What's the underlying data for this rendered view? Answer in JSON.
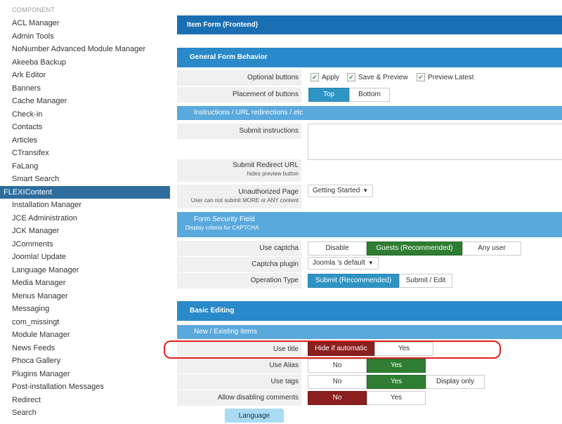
{
  "sidebar": {
    "section_label": "COMPONENT",
    "items": [
      "ACL Manager",
      "Admin Tools",
      "NoNumber Advanced Module Manager",
      "Akeeba Backup",
      "Ark Editor",
      "Banners",
      "Cache Manager",
      "Check-in",
      "Contacts",
      "Articles",
      "CTransifex",
      "FaLang",
      "Smart Search",
      "FLEXIContent",
      "Installation Manager",
      "JCE Administration",
      "JCK Manager",
      "JComments",
      "Joomla! Update",
      "Language Manager",
      "Media Manager",
      "Menus Manager",
      "Messaging",
      "com_missingt",
      "Module Manager",
      "News Feeds",
      "Phoca Gallery",
      "Plugins Manager",
      "Post-installation Messages",
      "Redirect",
      "Search"
    ],
    "active_index": 13
  },
  "main": {
    "item_form_title": "Item Form (Frontend)",
    "general_title": "General Form Behavior",
    "optional_buttons_label": "Optional buttons",
    "optional_buttons": [
      "Apply",
      "Save & Preview",
      "Preview Latest"
    ],
    "placement_label": "Placement of buttons",
    "placement_options": [
      "Top",
      "Bottom"
    ],
    "instructions_sub": "Instructions / URL redirections / etc",
    "submit_instructions_label": "Submit instructions",
    "submit_redirect_label": "Submit Redirect URL",
    "submit_redirect_help": "hides preview button",
    "unauthorized_label": "Unauthorized Page",
    "unauthorized_help": "User can not submit MORE or ANY content",
    "unauthorized_value": "Getting Started",
    "security_sub": "Form Security Field",
    "security_sub_help": "Display criteria for CAPTCHA",
    "use_captcha_label": "Use captcha",
    "use_captcha_options": [
      "Disable",
      "Guests (Recommended)",
      "Any user"
    ],
    "captcha_plugin_label": "Captcha plugin",
    "captcha_plugin_value": "Joomla 's default",
    "operation_type_label": "Operation Type",
    "operation_type_options": [
      "Submit (Recommended)",
      "Submit / Edit"
    ],
    "basic_editing_title": "Basic Editing",
    "new_existing_sub": "New / Existing items",
    "use_title_label": "Use title",
    "use_title_options": [
      "Hide if automatic",
      "Yes"
    ],
    "use_alias_label": "Use Alias",
    "use_alias_options": [
      "No",
      "Yes"
    ],
    "use_tags_label": "Use tags",
    "use_tags_options": [
      "No",
      "Yes",
      "Display only"
    ],
    "allow_comments_label": "Allow disabling comments",
    "allow_comments_options": [
      "No",
      "Yes"
    ],
    "language_tab": "Language"
  },
  "colors": {
    "header_dark": "#1a6fb3",
    "header_mid": "#2a89c9",
    "subheader": "#5aa9dd",
    "active_blue": "#2e94c4",
    "active_green": "#2e7d32",
    "active_red": "#8b1e1e",
    "highlight": "#e02020"
  }
}
